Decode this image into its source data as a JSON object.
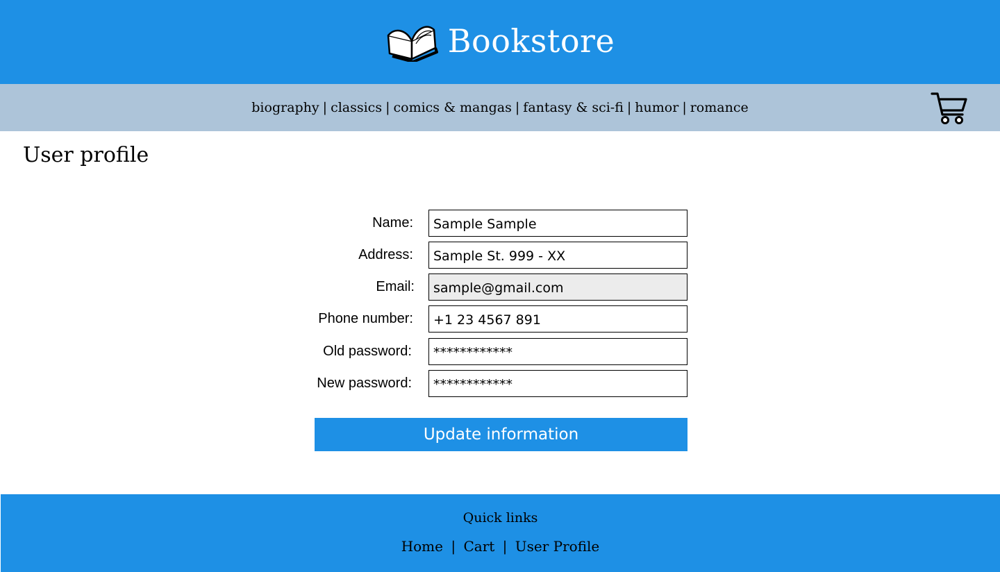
{
  "header": {
    "title": "Bookstore",
    "icon": "open-book-icon"
  },
  "nav": {
    "categories": [
      "biography",
      "classics",
      "comics & mangas",
      "fantasy & sci-fi",
      "humor",
      "romance"
    ],
    "separator": "|",
    "cart_icon": "shopping-cart-icon"
  },
  "page": {
    "title": "User profile"
  },
  "form": {
    "fields": [
      {
        "label": "Name:",
        "value": "Sample Sample",
        "disabled": false
      },
      {
        "label": "Address:",
        "value": "Sample St. 999 - XX",
        "disabled": false
      },
      {
        "label": "Email:",
        "value": "sample@gmail.com",
        "disabled": true
      },
      {
        "label": "Phone number:",
        "value": "+1 23 4567 891",
        "disabled": false
      },
      {
        "label": "Old password:",
        "value": "************",
        "disabled": false
      },
      {
        "label": "New password:",
        "value": "************",
        "disabled": false
      }
    ],
    "submit_label": "Update information"
  },
  "footer": {
    "title": "Quick links",
    "links": [
      "Home",
      "Cart",
      "User Profile"
    ],
    "separator": "|"
  },
  "colors": {
    "primary": "#1e90e5",
    "nav_background": "#adc4d9",
    "disabled_field": "#ececec"
  }
}
